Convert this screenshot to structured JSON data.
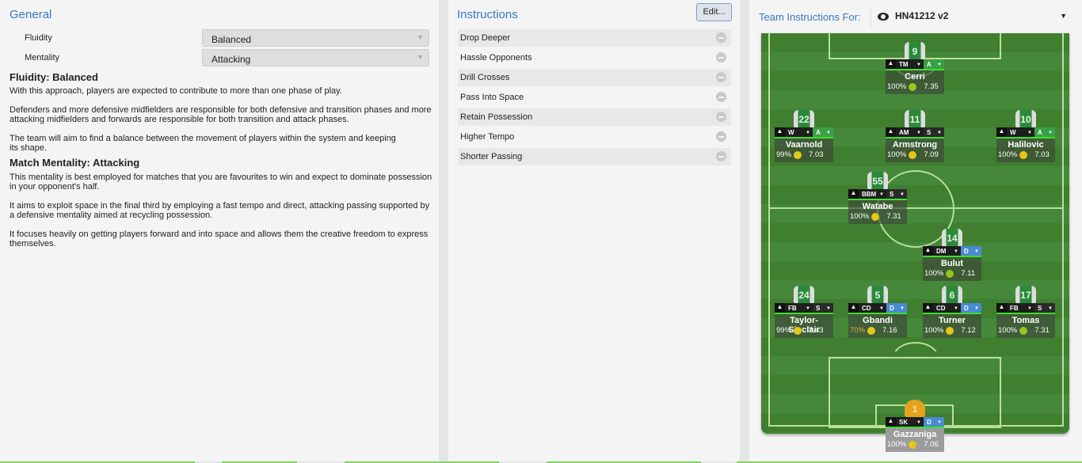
{
  "general": {
    "title": "General",
    "fluidity_label": "Fluidity",
    "fluidity_value": "Balanced",
    "mentality_label": "Mentality",
    "mentality_value": "Attacking",
    "fluidity_heading": "Fluidity: Balanced",
    "fluidity_paras": [
      "With this approach, players are expected to contribute to more than one phase of play.",
      "Defenders and more defensive midfielders are responsible for both defensive and transition phases and more attacking midfielders and forwards are responsible for both transition and attack phases.",
      "The team will aim to find a balance between the movement of players within the system and keeping its shape."
    ],
    "mentality_heading": "Match Mentality: Attacking",
    "mentality_paras": [
      "This mentality is best employed for matches that you are favourites to win and expect to dominate possession in your opponent's half.",
      "It aims to exploit space in the final third by employing a fast tempo and direct, attacking passing supported by a defensive mentality aimed at recycling possession.",
      "It focuses heavily on getting players forward and into space and allows them the creative freedom to express themselves."
    ]
  },
  "instructions": {
    "title": "Instructions",
    "edit_label": "Edit...",
    "items": [
      "Drop Deeper",
      "Hassle Opponents",
      "Drill Crosses",
      "Pass Into Space",
      "Retain Possession",
      "Higher Tempo",
      "Shorter Passing"
    ]
  },
  "team": {
    "label": "Team Instructions For:",
    "tactic": "HN41212 v2",
    "players": [
      {
        "num": "9",
        "role": "TM",
        "duty": "A",
        "name": "Cerri",
        "cond": "100%",
        "rating": "7.35",
        "trend": "down"
      },
      {
        "num": "22",
        "role": "W",
        "duty": "A",
        "name": "Vaarnold",
        "cond": "99%",
        "rating": "7.03",
        "trend": "right"
      },
      {
        "num": "11",
        "role": "AM",
        "duty": "S",
        "name": "Armstrong",
        "cond": "100%",
        "rating": "7.09",
        "trend": "right"
      },
      {
        "num": "10",
        "role": "W",
        "duty": "A",
        "name": "Halilovic",
        "cond": "100%",
        "rating": "7.03",
        "trend": "right"
      },
      {
        "num": "55",
        "role": "BBM",
        "duty": "S",
        "name": "Watabe",
        "cond": "100%",
        "rating": "7.31",
        "trend": "right"
      },
      {
        "num": "14",
        "role": "DM",
        "duty": "D",
        "name": "Bulut",
        "cond": "100%",
        "rating": "7.11",
        "trend": "down"
      },
      {
        "num": "24",
        "role": "FB",
        "duty": "S",
        "name": "Taylor-Sinclair",
        "cond": "99%",
        "rating": "7.43",
        "trend": "right"
      },
      {
        "num": "5",
        "role": "CD",
        "duty": "D",
        "name": "Gbandi",
        "cond": "70%",
        "rating": "7.16",
        "trend": "right"
      },
      {
        "num": "6",
        "role": "CD",
        "duty": "D",
        "name": "Turner",
        "cond": "100%",
        "rating": "7.12",
        "trend": "right"
      },
      {
        "num": "17",
        "role": "FB",
        "duty": "S",
        "name": "Tomas",
        "cond": "100%",
        "rating": "7.31",
        "trend": "down"
      },
      {
        "num": "1",
        "role": "SK",
        "duty": "D",
        "name": "Gazzaniga",
        "cond": "100%",
        "rating": "7.06",
        "trend": "right"
      }
    ]
  },
  "colors": {
    "accent": "#3a78c2",
    "attack": "#3aa046",
    "defend": "#4a8ad2",
    "pitch": "#3f7f2f"
  }
}
